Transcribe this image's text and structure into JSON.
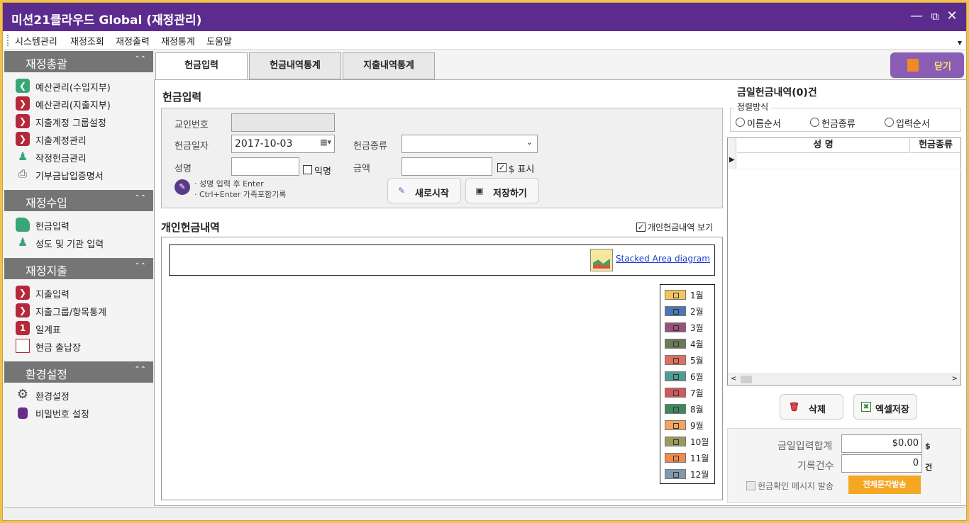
{
  "window": {
    "title": "미션21클라우드 Global (재정관리)"
  },
  "menu": [
    "시스템관리",
    "재정조회",
    "재정출력",
    "재정통계",
    "도움말"
  ],
  "sidebar": {
    "sections": [
      {
        "title": "재정총괄",
        "items": [
          "예산관리(수입지부)",
          "예산관리(지출지부)",
          "지출계정 그룹설정",
          "지출계정관리",
          "작정헌금관리",
          "기부금납입증명서"
        ]
      },
      {
        "title": "재정수입",
        "items": [
          "헌금입력",
          "성도 및 기관 입력"
        ]
      },
      {
        "title": "재정지출",
        "items": [
          "지출입력",
          "지출그룹/항목통계",
          "일계표",
          "현금 출납장"
        ]
      },
      {
        "title": "환경설정",
        "items": [
          "환경설정",
          "비밀번호 설정"
        ]
      }
    ],
    "daily_icon_text": "1"
  },
  "tabs": [
    "헌금입력",
    "헌금내역통계",
    "지출내역통계"
  ],
  "close_button": "닫기",
  "form": {
    "section_title": "헌금입력",
    "receipt_no_label": "교인번호",
    "receipt_no_value": "",
    "date_label": "헌금일자",
    "date_value": "2017-10-03",
    "type_label": "헌금종류",
    "type_value": "",
    "name_label": "성명",
    "name_value": "",
    "anonymous_label": "익명",
    "amount_label": "금액",
    "amount_value": "",
    "dollar_label": "$ 표시",
    "hint1": "· 성명 입력 후 Enter",
    "hint2": "· Ctrl+Enter 가족포함기록",
    "new_button": "새로시작",
    "save_button": "저장하기"
  },
  "personal": {
    "title": "개인헌금내역",
    "show_label": "개인헌금내역 보기",
    "chart_link": "Stacked Area diagram",
    "legend": [
      {
        "label": "1월",
        "color": "#f7c35c"
      },
      {
        "label": "2월",
        "color": "#4a78b5"
      },
      {
        "label": "3월",
        "color": "#9a4f7c"
      },
      {
        "label": "4월",
        "color": "#6a7a5a"
      },
      {
        "label": "5월",
        "color": "#e07060"
      },
      {
        "label": "6월",
        "color": "#4f9e94"
      },
      {
        "label": "7월",
        "color": "#d05a5a"
      },
      {
        "label": "8월",
        "color": "#3b8a5a"
      },
      {
        "label": "9월",
        "color": "#f4a460"
      },
      {
        "label": "10월",
        "color": "#9a9a5a"
      },
      {
        "label": "11월",
        "color": "#f08a50"
      },
      {
        "label": "12월",
        "color": "#7f9ab0"
      }
    ]
  },
  "today": {
    "title": "금일헌금내역(0)건",
    "sort_label": "정렬방식",
    "sort_options": [
      "이름순서",
      "헌금종류",
      "입력순서"
    ],
    "columns": [
      "성  명",
      "헌금종류"
    ],
    "delete_button": "삭제",
    "excel_button": "엑셀저장",
    "total_label": "금일입력합계",
    "total_value": "$0.00",
    "total_unit": "$",
    "count_label": "기록건수",
    "count_value": "0",
    "count_unit": "건",
    "sms_label": "헌금확인 메시지 발송",
    "sms_button": "전체문자발송"
  }
}
